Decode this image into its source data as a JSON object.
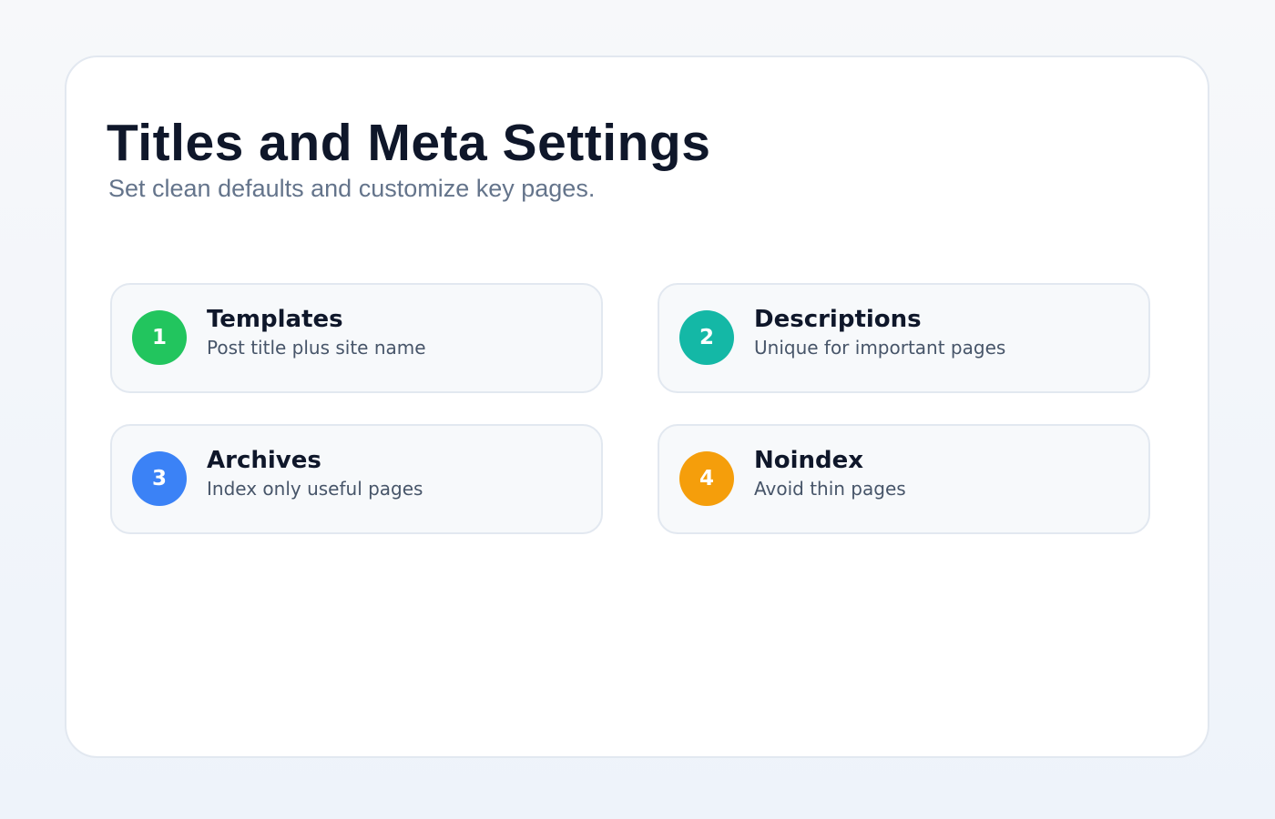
{
  "header": {
    "title": "Titles and Meta Settings",
    "subtitle": "Set clean defaults and customize key pages."
  },
  "items": [
    {
      "number": "1",
      "title": "Templates",
      "description": "Post title plus site name",
      "color": "#22c55e"
    },
    {
      "number": "2",
      "title": "Descriptions",
      "description": "Unique for important pages",
      "color": "#14b8a6"
    },
    {
      "number": "3",
      "title": "Archives",
      "description": "Index only useful pages",
      "color": "#3b82f6"
    },
    {
      "number": "4",
      "title": "Noindex",
      "description": "Avoid thin pages",
      "color": "#f59e0b"
    }
  ]
}
